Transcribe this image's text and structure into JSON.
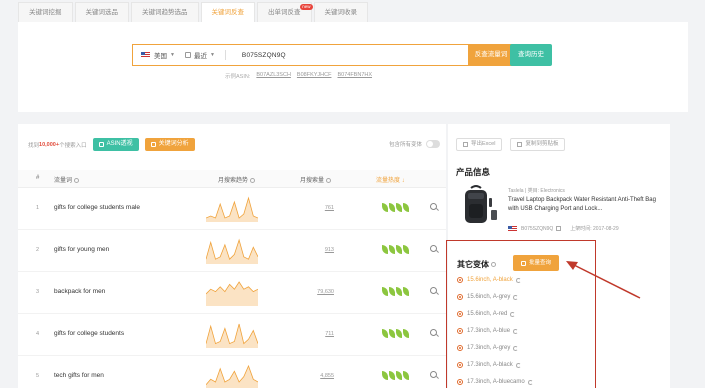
{
  "tabs": [
    {
      "label": "关键词挖掘",
      "active": false
    },
    {
      "label": "关键词选品",
      "active": false
    },
    {
      "label": "关键词趋势选品",
      "active": false
    },
    {
      "label": "关键词反查",
      "active": true
    },
    {
      "label": "出单词反查",
      "active": false,
      "badge": "new"
    },
    {
      "label": "关键词收录",
      "active": false
    }
  ],
  "search": {
    "country": "美国",
    "period": "最近",
    "asin_value": "B075SZQN9Q",
    "search_button": "反查流量词",
    "history_button": "查询历史",
    "examples_label": "示例ASIN:",
    "examples": [
      "B07AZL3SCH",
      "B08FKYJHCF",
      "B074FBN7HX"
    ]
  },
  "toolbar": {
    "prefix": "找到",
    "count": "10,000+",
    "suffix": "个搜索入口",
    "asin_button": "ASIN透视",
    "kw_button": "关键词分析",
    "toggle_label": "包含所有变体"
  },
  "table": {
    "headers": {
      "idx": "#",
      "keyword": "流量词",
      "trend": "月搜索趋势",
      "volume": "月搜索量",
      "score": "流量热度 ↓"
    },
    "rows": [
      {
        "idx": "1",
        "keyword": "gifts for college students male",
        "volume": "761",
        "trend": [
          2,
          3,
          2,
          9,
          2,
          3,
          10,
          2,
          4,
          12,
          3,
          2
        ],
        "leaves": 4
      },
      {
        "idx": "2",
        "keyword": "gifts for young men",
        "volume": "913",
        "trend": [
          2,
          9,
          2,
          3,
          8,
          2,
          4,
          10,
          3,
          2,
          7,
          3
        ],
        "leaves": 4
      },
      {
        "idx": "3",
        "keyword": "backpack for men",
        "volume": "79,630",
        "trend": [
          5,
          7,
          6,
          8,
          6,
          9,
          7,
          10,
          7,
          8,
          6,
          7
        ],
        "leaves": 4
      },
      {
        "idx": "4",
        "keyword": "gifts for college students",
        "volume": "711",
        "trend": [
          2,
          10,
          2,
          3,
          9,
          2,
          3,
          11,
          2,
          4,
          8,
          2
        ],
        "leaves": 4
      },
      {
        "idx": "5",
        "keyword": "tech gifts for men",
        "volume": "4,855",
        "trend": [
          2,
          4,
          3,
          8,
          3,
          4,
          7,
          3,
          5,
          9,
          4,
          3
        ],
        "leaves": 4
      }
    ]
  },
  "side": {
    "export_button": "导出Excel",
    "copy_button": "复制到剪贴板",
    "section_title": "产品信息",
    "brand": "Taslela | 类目: Electronics",
    "title": "Travel Laptop Backpack Water Resistant Anti-Theft Bag with USB Charging Port and Lock...",
    "asin": "B075SZQN9Q",
    "listed": "上架时间: 2017-08-29"
  },
  "variants": {
    "title": "其它变体",
    "button": "批量查询",
    "items": [
      "15.6inch, A-black",
      "15.6inch, A-grey",
      "15.6inch, A-red",
      "17.3inch, A-blue",
      "17.3inch, A-grey",
      "17.3inch, A-black",
      "17.3inch, A-bluecamo"
    ]
  },
  "colors": {
    "accent": "#f0a33c",
    "teal": "#3ec0a4",
    "highlight": "#c0392b"
  }
}
